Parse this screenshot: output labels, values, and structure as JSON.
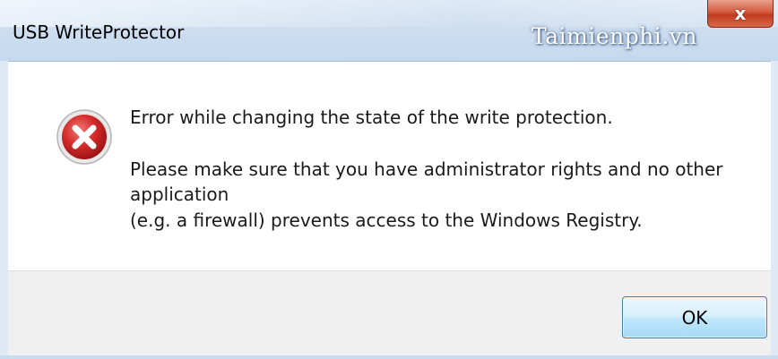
{
  "window": {
    "title": "USB WriteProtector",
    "close_label": "x",
    "watermark": "Taimienphi.vn"
  },
  "dialog": {
    "icon": "error-icon",
    "message_lines": [
      "Error while changing the state of the write protection.",
      "Please make sure that you have administrator rights and no other",
      "application",
      "(e.g. a firewall) prevents access to the Windows Registry."
    ],
    "ok_label": "OK"
  },
  "colors": {
    "title_bar": "#cfdff0",
    "close_button": "#c94a2d",
    "error_red": "#c8232b",
    "ok_border": "#3c7fb1"
  }
}
